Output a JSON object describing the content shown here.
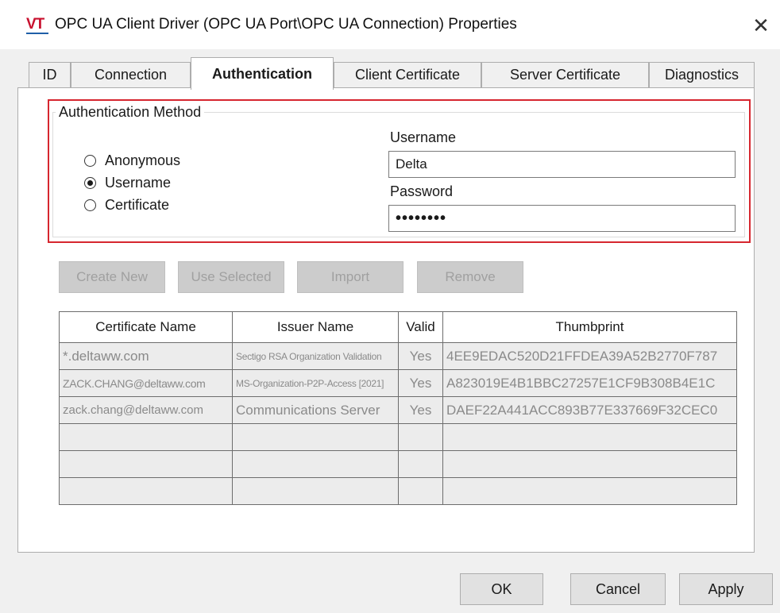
{
  "window": {
    "logo_text": "VT",
    "title": "OPC UA Client Driver (OPC UA Port\\OPC UA Connection) Properties",
    "close_glyph": "✕"
  },
  "tabs": [
    {
      "label": "ID",
      "active": false
    },
    {
      "label": "Connection",
      "active": false
    },
    {
      "label": "Authentication",
      "active": true
    },
    {
      "label": "Client Certificate",
      "active": false
    },
    {
      "label": "Server Certificate",
      "active": false
    },
    {
      "label": "Diagnostics",
      "active": false
    }
  ],
  "auth": {
    "group_title": "Authentication Method",
    "methods": [
      {
        "label": "Anonymous",
        "selected": false
      },
      {
        "label": "Username",
        "selected": true
      },
      {
        "label": "Certificate",
        "selected": false
      }
    ],
    "username_label": "Username",
    "username_value": "Delta",
    "password_label": "Password",
    "password_value": "••••••••",
    "highlight_color": "#d6262f"
  },
  "cert_buttons": {
    "create_new": "Create New",
    "use_selected": "Use Selected",
    "import": "Import",
    "remove": "Remove"
  },
  "cert_table": {
    "headers": [
      "Certificate Name",
      "Issuer Name",
      "Valid",
      "Thumbprint"
    ],
    "rows": [
      [
        "*.deltaww.com",
        "Sectigo RSA Organization Validation",
        "Yes",
        "4EE9EDAC520D21FFDEA39A52B2770F787"
      ],
      [
        "ZACK.CHANG@deltaww.com",
        "MS-Organization-P2P-Access [2021]",
        "Yes",
        "A823019E4B1BBC27257E1CF9B308B4E1C"
      ],
      [
        "zack.chang@deltaww.com",
        "Communications Server",
        "Yes",
        "DAEF22A441ACC893B77E337669F32CEC0"
      ],
      [
        "",
        "",
        "",
        ""
      ],
      [
        "",
        "",
        "",
        ""
      ],
      [
        "",
        "",
        "",
        ""
      ]
    ]
  },
  "footer": {
    "ok": "OK",
    "cancel": "Cancel",
    "apply": "Apply"
  }
}
